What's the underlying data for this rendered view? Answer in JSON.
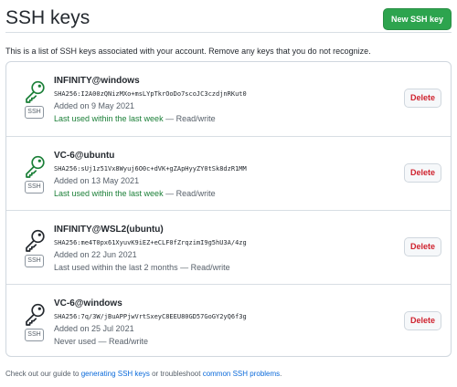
{
  "page": {
    "title": "SSH keys",
    "new_key_button": "New SSH key",
    "intro": "This is a list of SSH keys associated with your account. Remove any keys that you do not recognize."
  },
  "colors": {
    "accent_green": "#2da44e",
    "recent_text_green": "#1a7f37",
    "danger_red": "#cf222e",
    "link_blue": "#0969da",
    "icon_recent": "#1a7f37",
    "icon_stale": "#24292f"
  },
  "keys": [
    {
      "title": "INFINITY@windows",
      "fingerprint": "SHA256:I2A00zQNizMXo+msLYpTkrOoDo7scoJC3czdjnRKut0",
      "added": "Added on 9 May 2021",
      "last_used": "Last used within the last week",
      "access": " — Read/write",
      "recent": true,
      "badge": "SSH",
      "icon": "key-icon",
      "delete_label": "Delete"
    },
    {
      "title": "VC-6@ubuntu",
      "fingerprint": "SHA256:sUj1z51Vx8Wyuj6O0c+dVK+gZApHyyZY0tSk8dzR1MM",
      "added": "Added on 13 May 2021",
      "last_used": "Last used within the last week",
      "access": " — Read/write",
      "recent": true,
      "badge": "SSH",
      "icon": "key-icon",
      "delete_label": "Delete"
    },
    {
      "title": "INFINITY@WSL2(ubuntu)",
      "fingerprint": "SHA256:me4T0px61XyuvK9iEZ+eCLF0fZrqzimI9g5hU3A/4zg",
      "added": "Added on 22 Jun 2021",
      "last_used": "Last used within the last 2 months",
      "access": " — Read/write",
      "recent": false,
      "badge": "SSH",
      "icon": "key-icon",
      "delete_label": "Delete"
    },
    {
      "title": "VC-6@windows",
      "fingerprint": "SHA256:7q/3W/jBuAPPjwVrtSxeyC8EEU80GD57GoGY2yQ6f3g",
      "added": "Added on 25 Jul 2021",
      "last_used": "Never used",
      "access": " — Read/write",
      "recent": false,
      "badge": "SSH",
      "icon": "key-icon",
      "delete_label": "Delete"
    }
  ],
  "footer": {
    "prefix": "Check out our guide to ",
    "link1": "generating SSH keys",
    "middle": " or troubleshoot ",
    "link2": "common SSH problems",
    "suffix": "."
  }
}
